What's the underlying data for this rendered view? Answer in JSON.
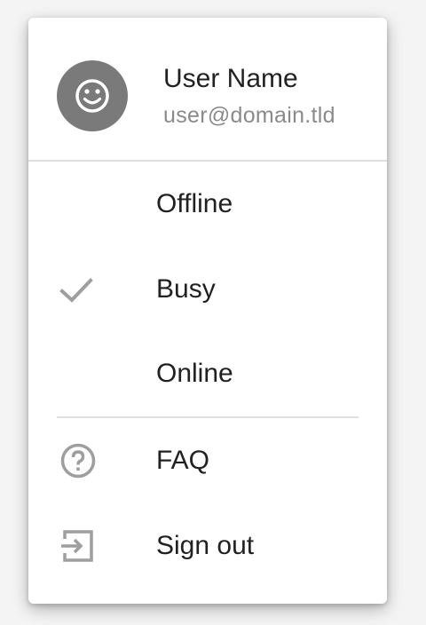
{
  "user": {
    "name": "User Name",
    "email": "user@domain.tld",
    "avatar_icon": "smiley-face-icon"
  },
  "status_items": [
    {
      "label": "Offline",
      "selected": false
    },
    {
      "label": "Busy",
      "selected": true,
      "icon": "checkmark-icon"
    },
    {
      "label": "Online",
      "selected": false
    }
  ],
  "action_items": [
    {
      "label": "FAQ",
      "icon": "help-circle-icon"
    },
    {
      "label": "Sign out",
      "icon": "sign-out-icon"
    }
  ],
  "colors": {
    "avatar_bg": "#7a7a7a",
    "icon_gray": "#9e9e9e",
    "divider": "#e0e0e0",
    "text_primary": "#212121",
    "text_secondary": "#8a8a8a"
  }
}
